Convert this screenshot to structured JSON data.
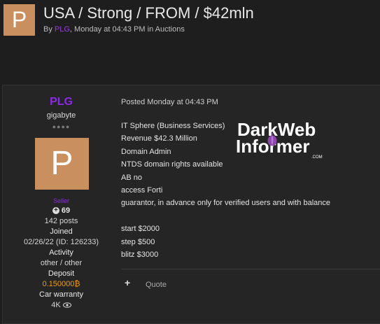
{
  "thread": {
    "avatar_letter": "P",
    "title": "USA / Strong / FROM / $42mln",
    "meta": {
      "by": "By",
      "author": "PLG",
      "date": "Monday at 04:43 PM",
      "in": "in",
      "forum": "Auctions"
    }
  },
  "user": {
    "name": "PLG",
    "title": "gigabyte",
    "dots": "●●●●",
    "avatar_letter": "P",
    "role": "Seller",
    "reputation": "69",
    "posts": "142 posts",
    "joined_label": "Joined",
    "joined_value": "02/26/22 (ID: 126233)",
    "activity_label": "Activity",
    "activity_value": "other / other",
    "deposit_label": "Deposit",
    "deposit_value": "0.150000₿",
    "warranty_label": "Car warranty",
    "warranty_value": "4K"
  },
  "post": {
    "posted": "Posted Monday at 04:43 PM",
    "lines": [
      "IT Sphere (Business Services)",
      "Revenue $42.3 Million",
      "Domain Admin",
      "NTDS domain rights available",
      "AB no",
      "access Forti",
      "guarantor, in advance only for verified users and with balance",
      "",
      "start $2000",
      "step $500",
      "blitz $3000"
    ],
    "actions": {
      "plus": "+",
      "quote": "Quote"
    }
  },
  "watermark": {
    "line1": "DarkWeb",
    "line2": "Informer",
    "suffix": ".COM"
  }
}
